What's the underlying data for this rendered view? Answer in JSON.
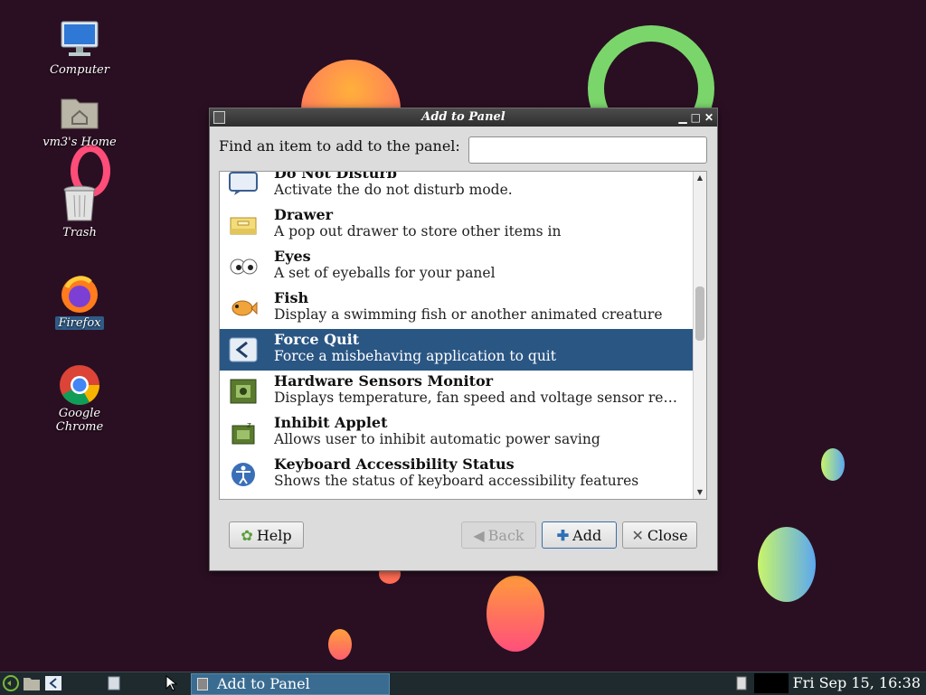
{
  "desktop": {
    "icons": [
      {
        "label": "Computer"
      },
      {
        "label": "vm3's Home"
      },
      {
        "label": "Trash"
      },
      {
        "label": "Firefox"
      },
      {
        "label": "Google Chrome"
      }
    ]
  },
  "dialog": {
    "title": "Add to Panel",
    "find_label": "Find an item to add to the panel:",
    "search_value": "",
    "items": [
      {
        "title": "Do Not Disturb",
        "desc": "Activate the do not disturb mode.",
        "icon": "monitor-speech-icon"
      },
      {
        "title": "Drawer",
        "desc": "A pop out drawer to store other items in",
        "icon": "drawer-icon"
      },
      {
        "title": "Eyes",
        "desc": "A set of eyeballs for your panel",
        "icon": "eyes-icon"
      },
      {
        "title": "Fish",
        "desc": "Display a swimming fish or another animated creature",
        "icon": "fish-icon"
      },
      {
        "title": "Force Quit",
        "desc": "Force a misbehaving application to quit",
        "icon": "force-quit-icon",
        "selected": true
      },
      {
        "title": "Hardware Sensors Monitor",
        "desc": "Displays temperature, fan speed and voltage sensor readings",
        "icon": "chip-icon"
      },
      {
        "title": "Inhibit Applet",
        "desc": "Allows user to inhibit automatic power saving",
        "icon": "chip-sleep-icon"
      },
      {
        "title": "Keyboard Accessibility Status",
        "desc": "Shows the status of keyboard accessibility features",
        "icon": "accessibility-icon"
      }
    ],
    "buttons": {
      "help": "Help",
      "back": "Back",
      "add": "Add",
      "close": "Close"
    }
  },
  "taskbar": {
    "task_title": "Add to Panel",
    "clock": "Fri Sep 15, 16:38"
  }
}
